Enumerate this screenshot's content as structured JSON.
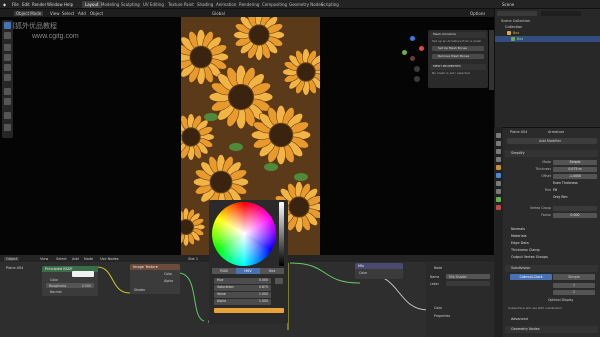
{
  "topbar": {
    "menu": [
      "File",
      "Edit",
      "Render",
      "Window",
      "Help"
    ],
    "workspaces": [
      "Layout",
      "Modeling",
      "Sculpting",
      "UV Editing",
      "Texture Paint",
      "Shading",
      "Animation",
      "Rendering",
      "Compositing",
      "Geometry Nodes",
      "Scripting"
    ],
    "active_workspace": "Layout",
    "scene": "Scene"
  },
  "viewport": {
    "mode": "Object Mode",
    "menu": [
      "View",
      "Select",
      "Add",
      "Object"
    ],
    "transform": "Global",
    "options": "Options"
  },
  "watermark": {
    "line1": "翼狐外优品教程",
    "line2": "www.cgitg.com"
  },
  "npanel": {
    "title": "Mesh Armature",
    "text1": "Set up an Armature from a mesh",
    "btn1": "Set Up Mesh Bones",
    "btn2": "Remove Mesh Bones",
    "section2": "MESH PROPERTIES",
    "text2": "No mesh is set / selected"
  },
  "outliner": {
    "title": "Scene Collection",
    "items": [
      "Collection",
      "Bez",
      "Bez"
    ],
    "search": ""
  },
  "properties": {
    "object": "Plane.004",
    "modifier": "Armature",
    "add_modifier": "Add Modifier",
    "section": "Simplify",
    "rows": [
      {
        "label": "Mode",
        "value": "Simple"
      },
      {
        "label": "Thickness",
        "value": "0.075 m"
      },
      {
        "label": "Offset",
        "value": "-1.0000"
      },
      {
        "label": "",
        "value": "Even Thickness"
      },
      {
        "label": "Rim",
        "value": "Fill"
      },
      {
        "label": "",
        "value": "Only Rim"
      },
      {
        "label": "Vertex Group",
        "value": ""
      },
      {
        "label": "Factor",
        "value": "0.000"
      }
    ],
    "subsections": [
      "Normals",
      "Materials",
      "Edge Data",
      "Thickness Clamp",
      "Output Vertex Groups"
    ],
    "subdivision": "Subdivision",
    "sub_tabs": [
      "Catmull-Clark",
      "Simple"
    ],
    "levels_viewport": "1",
    "render": "2",
    "optimal_display": "Optimal Display",
    "note": "Subsurface will use GPU subdivision",
    "advanced": "Advanced",
    "geometry": "Geometry Nodes"
  },
  "node_editor": {
    "menu": [
      "Object",
      "View",
      "Select",
      "Add",
      "Node"
    ],
    "use_nodes": "Use Nodes",
    "slot": "Slot 1",
    "material": "Plane.004",
    "nodes": {
      "bsdf": {
        "title": "Principled BSDF",
        "label": "BSDF",
        "color": "Color",
        "roughness_label": "Roughness",
        "roughness": "0.500",
        "normal": "Normal"
      },
      "texture": {
        "title": "Image Texture",
        "color": "Color",
        "alpha": "Alpha",
        "shader": "Shader"
      },
      "mix": {
        "title": "Mix",
        "color": "Color",
        "fac": "Fac"
      }
    },
    "side": {
      "title": "Node",
      "name_label": "Name",
      "name": "Mix Shader",
      "label_label": "Label",
      "properties": "Properties",
      "color": "Color",
      "props": "Properties"
    }
  },
  "color_picker": {
    "modes": [
      "RGB",
      "HSV",
      "Hex"
    ],
    "active_mode": "HSV",
    "fields": [
      {
        "label": "Hue",
        "value": "0.000"
      },
      {
        "label": "Saturation",
        "value": "0.875"
      },
      {
        "label": "Value",
        "value": "1.000"
      },
      {
        "label": "Alpha",
        "value": "1.000"
      }
    ],
    "swatch_color": "#e8a33a"
  }
}
